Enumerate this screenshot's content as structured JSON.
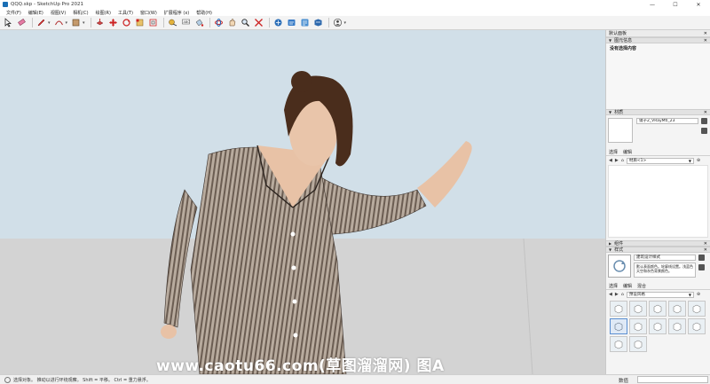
{
  "titlebar": {
    "title": "QQQ.skp - SketchUp Pro 2021",
    "minimize": "—",
    "maximize": "☐",
    "close": "✕"
  },
  "menus": [
    "文件(F)",
    "编辑(E)",
    "视图(V)",
    "相机(C)",
    "绘图(R)",
    "工具(T)",
    "窗口(W)",
    "扩展程序 (x)",
    "帮助(H)"
  ],
  "toolbar": {
    "tools": [
      "select-icon",
      "eraser-icon",
      "pencil-icon",
      "arc-icon",
      "rectangle-icon",
      "push-pull-icon",
      "move-icon",
      "rotate-icon",
      "scale-icon",
      "offset-icon",
      "tape-measure-icon",
      "text-icon",
      "paint-bucket-icon",
      "orbit-icon",
      "pan-icon",
      "zoom-icon",
      "zoom-extents-icon",
      "warehouse-icon",
      "extension-warehouse-icon",
      "layout-icon",
      "extension-manager-icon",
      "profile-icon"
    ]
  },
  "viewport": {
    "watermark": "www.caotu66.com(草图溜溜网) 图A",
    "sky_color": "#d1dfe8",
    "ground_color": "#d3d3d3"
  },
  "tray": {
    "title": "默认面板",
    "close": "✕",
    "entity_info": {
      "header": "图元信息",
      "value": "没有选择内容"
    },
    "materials": {
      "header": "材质",
      "name": "镜子2_VRayMtl_23",
      "tabs": [
        "选择",
        "编辑"
      ],
      "library": "材质<1>"
    },
    "components": {
      "header": "组件"
    },
    "styles": {
      "header": "样式",
      "name": "建筑设计样式",
      "description": "默认表面颜色。轮廓线设置。浅蓝色天空和灰色背景颜色。",
      "tabs": [
        "选择",
        "编辑",
        "混合"
      ],
      "collection": "预设风格"
    }
  },
  "statusbar": {
    "hint": "选择对象。 推动以进行环绕观察。 Shift = 平移。 Ctrl = 重力悬浮。",
    "measure_label": "数值",
    "measure_value": ""
  }
}
